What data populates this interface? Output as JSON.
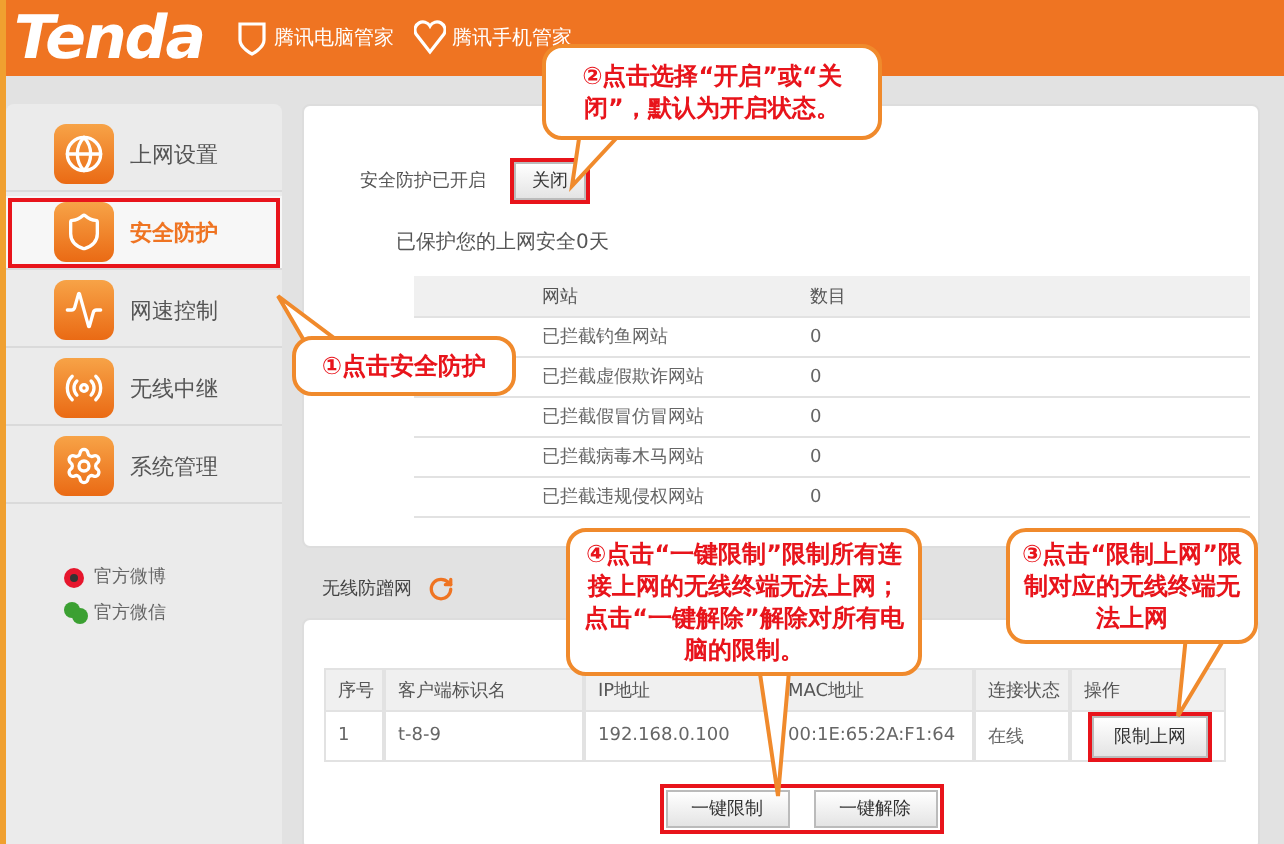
{
  "header": {
    "logo": "Tenda",
    "links": [
      {
        "label": "腾讯电脑管家"
      },
      {
        "label": "腾讯手机管家"
      }
    ]
  },
  "sidebar": {
    "items": [
      {
        "label": "上网设置",
        "selected": false,
        "highlighted": false
      },
      {
        "label": "安全防护",
        "selected": true,
        "highlighted": true
      },
      {
        "label": "网速控制",
        "selected": false,
        "highlighted": false
      },
      {
        "label": "无线中继",
        "selected": false,
        "highlighted": false
      },
      {
        "label": "系统管理",
        "selected": false,
        "highlighted": false
      }
    ],
    "social": [
      {
        "label": "官方微博"
      },
      {
        "label": "官方微信"
      }
    ]
  },
  "protection": {
    "status": "安全防护已开启",
    "button": {
      "label": "关闭",
      "highlighted": true
    },
    "summary": "已保护您的上网安全0天",
    "table": {
      "columns": [
        "网站",
        "数目"
      ],
      "rows": [
        [
          "已拦截钓鱼网站",
          "0"
        ],
        [
          "已拦截虚假欺诈网站",
          "0"
        ],
        [
          "已拦截假冒仿冒网站",
          "0"
        ],
        [
          "已拦截病毒木马网站",
          "0"
        ],
        [
          "已拦截违规侵权网站",
          "0"
        ]
      ]
    }
  },
  "wireless": {
    "title": "无线防蹭网",
    "table": {
      "columns": [
        "序号",
        "客户端标识名",
        "IP地址",
        "MAC地址",
        "连接状态",
        "操作"
      ],
      "rows": [
        {
          "cells": [
            "1",
            "t-8-9",
            "192.168.0.100",
            "00:1E:65:2A:F1:64",
            "在线"
          ],
          "action": {
            "label": "限制上网",
            "highlighted": true
          }
        }
      ]
    },
    "actions": {
      "highlighted": true,
      "buttons": [
        "一键限制",
        "一键解除"
      ]
    }
  },
  "callouts": [
    {
      "text": "①点击安全防护"
    },
    {
      "text": "②点击选择“开启”或“关闭”，默认为开启状态。"
    },
    {
      "text": "④点击“一键限制”限制所有连接上网的无线终端无法上网；点击“一键解除”解除对所有电脑的限制。"
    },
    {
      "text": "③点击“限制上网”限制对应的无线终端无法上网"
    }
  ]
}
